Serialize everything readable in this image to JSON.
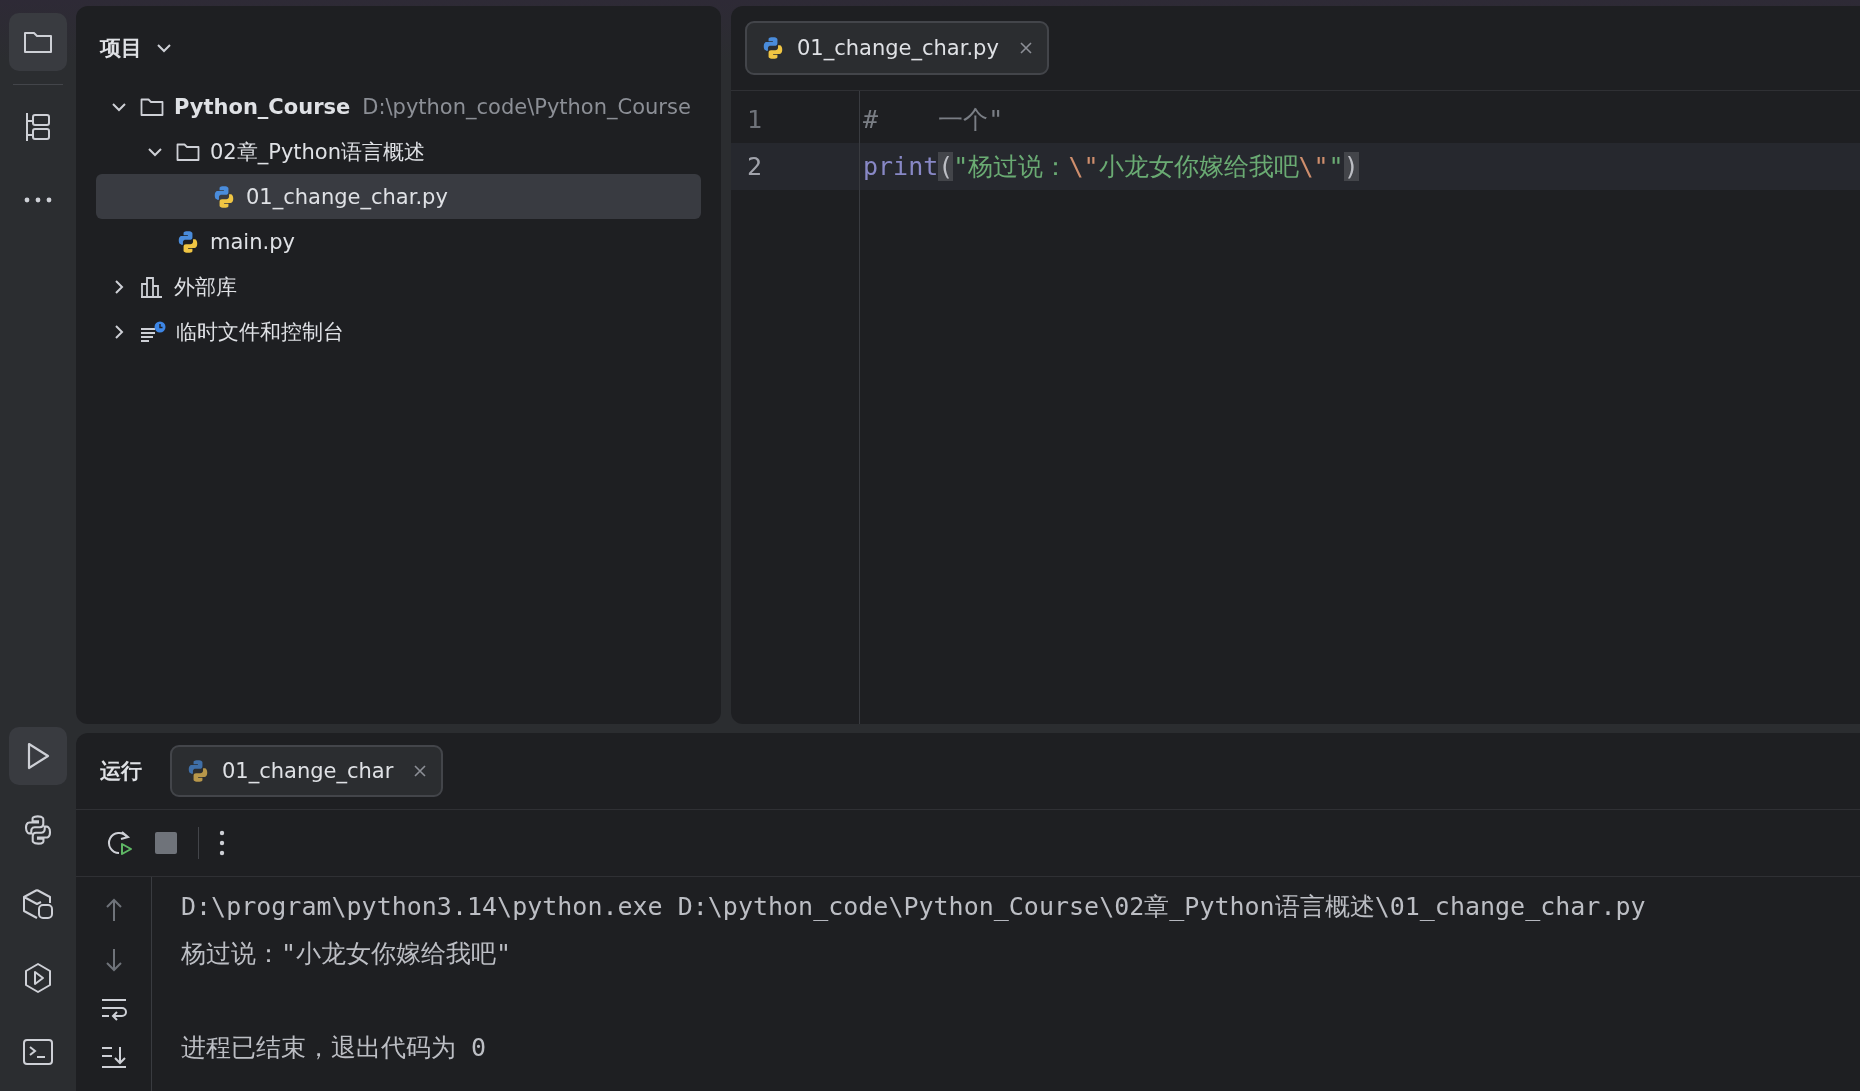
{
  "tool_strip": [
    {
      "kind": "project",
      "selected": true
    },
    {
      "kind": "structure",
      "selected": false
    },
    {
      "kind": "more",
      "selected": false
    },
    {
      "kind": "run",
      "selected": true
    },
    {
      "kind": "python-console",
      "selected": false
    },
    {
      "kind": "packages",
      "selected": false
    },
    {
      "kind": "services",
      "selected": false
    },
    {
      "kind": "terminal",
      "selected": false
    }
  ],
  "project_panel": {
    "title": "项目",
    "tree": [
      {
        "kind": "folder",
        "label": "Python_Course",
        "path": "D:\\python_code\\Python_Course",
        "expanded": true,
        "selected": false,
        "children": [
          {
            "kind": "folder",
            "label": "02章_Python语言概述",
            "expanded": true,
            "selected": false,
            "children": [
              {
                "kind": "python",
                "label": "01_change_char.py",
                "selected": true
              }
            ]
          },
          {
            "kind": "python",
            "label": "main.py",
            "selected": false
          }
        ]
      },
      {
        "kind": "library",
        "label": "外部库",
        "expanded": false,
        "selected": false
      },
      {
        "kind": "scratch",
        "label": "临时文件和控制台",
        "expanded": false,
        "selected": false
      }
    ]
  },
  "editor": {
    "tabs": [
      {
        "label": "01_change_char.py",
        "selected": true
      }
    ],
    "lines": [
      {
        "number": "1",
        "current": false,
        "tokens": [
          {
            "kind": "comment",
            "text": "#    一个\""
          }
        ]
      },
      {
        "number": "2",
        "current": true,
        "tokens": [
          {
            "kind": "builtin",
            "text": "print"
          },
          {
            "kind": "bracket",
            "text": "("
          },
          {
            "kind": "string",
            "text": "\"杨过说："
          },
          {
            "kind": "escape",
            "text": "\\\""
          },
          {
            "kind": "string",
            "text": "小龙女你嫁给我吧"
          },
          {
            "kind": "escape",
            "text": "\\\""
          },
          {
            "kind": "string",
            "text": "\""
          },
          {
            "kind": "bracket",
            "text": ")"
          }
        ]
      }
    ]
  },
  "run_panel": {
    "title": "运行",
    "tabs": [
      {
        "label": "01_change_char",
        "selected": true
      }
    ],
    "console": [
      {
        "kind": "command",
        "text": "D:\\program\\python3.14\\python.exe D:\\python_code\\Python_Course\\02章_Python语言概述\\01_change_char.py"
      },
      {
        "kind": "output",
        "text": "杨过说：\"小龙女你嫁给我吧\""
      },
      {
        "kind": "status",
        "text": "进程已结束，退出代码为 0"
      }
    ]
  }
}
